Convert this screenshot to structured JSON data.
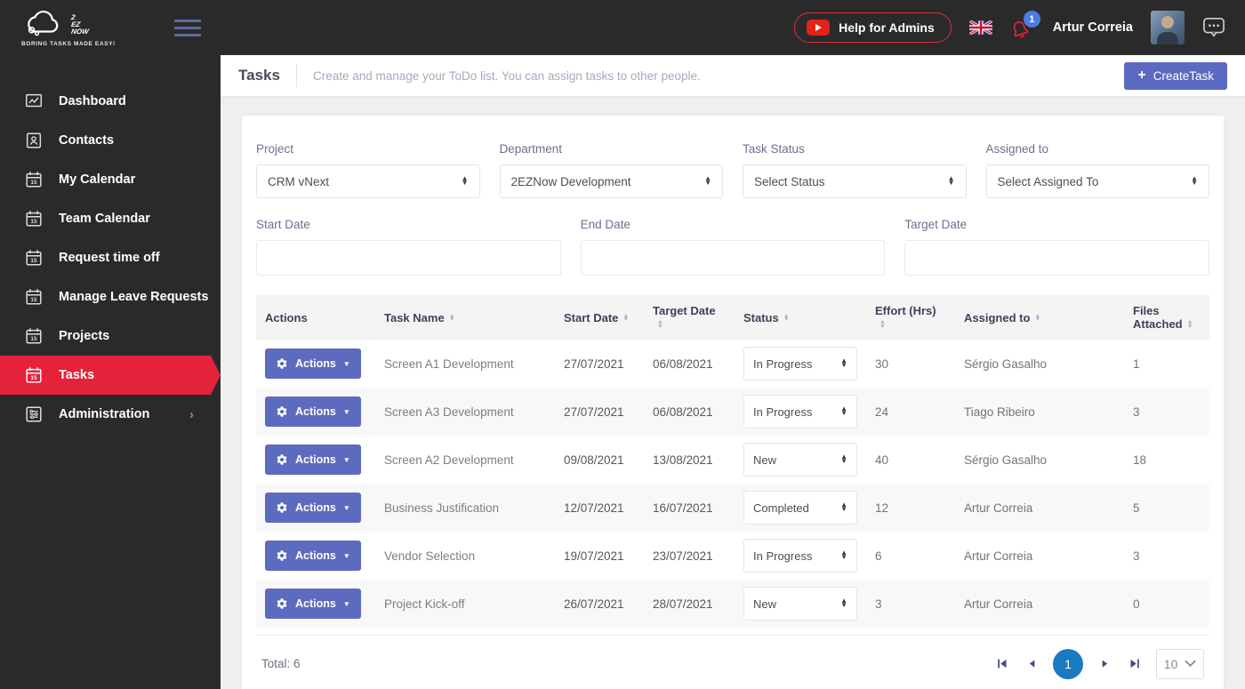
{
  "app": {
    "logo_lines": [
      "2",
      "EZ",
      "NOW"
    ],
    "tagline": "BORING TASKS MADE EASY!"
  },
  "topbar": {
    "help_button": "Help for Admins",
    "notification_count": "1",
    "user_name": "Artur Correia"
  },
  "sidebar": {
    "items": [
      {
        "label": "Dashboard",
        "icon": "chart-icon"
      },
      {
        "label": "Contacts",
        "icon": "contacts-icon"
      },
      {
        "label": "My Calendar",
        "icon": "calendar-icon"
      },
      {
        "label": "Team Calendar",
        "icon": "calendar-icon"
      },
      {
        "label": "Request time off",
        "icon": "calendar-icon"
      },
      {
        "label": "Manage Leave Requests",
        "icon": "calendar-icon"
      },
      {
        "label": "Projects",
        "icon": "calendar-icon"
      },
      {
        "label": "Tasks",
        "icon": "calendar-icon",
        "active": true
      },
      {
        "label": "Administration",
        "icon": "admin-icon",
        "chevron": "›"
      }
    ]
  },
  "page_header": {
    "title": "Tasks",
    "subtitle": "Create and manage your ToDo list. You can assign tasks to other people.",
    "create_button": "CreateTask",
    "create_plus": "+"
  },
  "filters": {
    "project": {
      "label": "Project",
      "value": "CRM vNext"
    },
    "department": {
      "label": "Department",
      "value": "2EZNow Development"
    },
    "task_status": {
      "label": "Task Status",
      "value": "Select Status"
    },
    "assigned_to": {
      "label": "Assigned to",
      "value": "Select Assigned To"
    },
    "start_date": {
      "label": "Start Date",
      "value": ""
    },
    "end_date": {
      "label": "End Date",
      "value": ""
    },
    "target_date": {
      "label": "Target Date",
      "value": ""
    }
  },
  "table": {
    "columns": [
      "Actions",
      "Task Name",
      "Start Date",
      "Target Date",
      "Status",
      "Effort (Hrs)",
      "Assigned to",
      "Files Attached"
    ],
    "action_button_label": "Actions",
    "rows": [
      {
        "task_name": "Screen A1 Development",
        "start_date": "27/07/2021",
        "target_date": "06/08/2021",
        "status": "In Progress",
        "effort": "30",
        "assigned_to": "Sérgio Gasalho",
        "files": "1"
      },
      {
        "task_name": "Screen A3 Development",
        "start_date": "27/07/2021",
        "target_date": "06/08/2021",
        "status": "In Progress",
        "effort": "24",
        "assigned_to": "Tiago Ribeiro",
        "files": "3"
      },
      {
        "task_name": "Screen A2 Development",
        "start_date": "09/08/2021",
        "target_date": "13/08/2021",
        "status": "New",
        "effort": "40",
        "assigned_to": "Sérgio Gasalho",
        "files": "18"
      },
      {
        "task_name": "Business Justification",
        "start_date": "12/07/2021",
        "target_date": "16/07/2021",
        "status": "Completed",
        "effort": "12",
        "assigned_to": "Artur Correia",
        "files": "5"
      },
      {
        "task_name": "Vendor Selection",
        "start_date": "19/07/2021",
        "target_date": "23/07/2021",
        "status": "In Progress",
        "effort": "6",
        "assigned_to": "Artur Correia",
        "files": "3"
      },
      {
        "task_name": "Project Kick-off",
        "start_date": "26/07/2021",
        "target_date": "28/07/2021",
        "status": "New",
        "effort": "3",
        "assigned_to": "Artur Correia",
        "files": "0"
      }
    ]
  },
  "pagination": {
    "total": "Total: 6",
    "current_page": "1",
    "page_size": "10"
  },
  "colors": {
    "accent_red": "#e42239",
    "accent_indigo": "#5c6bc0",
    "pagination_blue": "#1b79c2",
    "badge_blue": "#4a7de2",
    "youtube_red": "#e62117",
    "dark_bg": "#2a2a2a"
  }
}
